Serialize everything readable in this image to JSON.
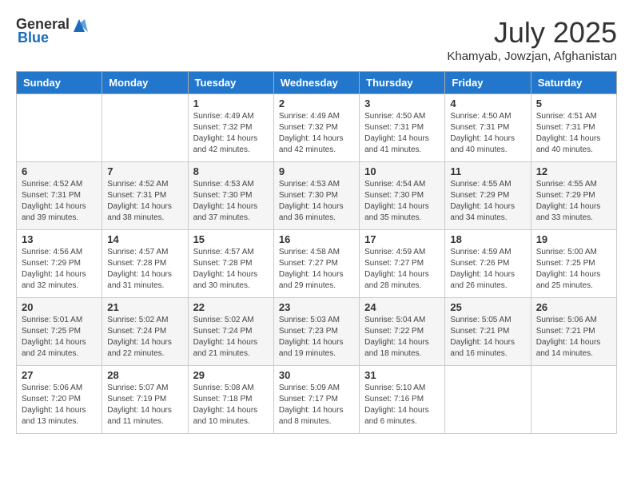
{
  "header": {
    "logo_general": "General",
    "logo_blue": "Blue",
    "month": "July 2025",
    "location": "Khamyab, Jowzjan, Afghanistan"
  },
  "weekdays": [
    "Sunday",
    "Monday",
    "Tuesday",
    "Wednesday",
    "Thursday",
    "Friday",
    "Saturday"
  ],
  "weeks": [
    [
      {
        "day": "",
        "sunrise": "",
        "sunset": "",
        "daylight": ""
      },
      {
        "day": "",
        "sunrise": "",
        "sunset": "",
        "daylight": ""
      },
      {
        "day": "1",
        "sunrise": "Sunrise: 4:49 AM",
        "sunset": "Sunset: 7:32 PM",
        "daylight": "Daylight: 14 hours and 42 minutes."
      },
      {
        "day": "2",
        "sunrise": "Sunrise: 4:49 AM",
        "sunset": "Sunset: 7:32 PM",
        "daylight": "Daylight: 14 hours and 42 minutes."
      },
      {
        "day": "3",
        "sunrise": "Sunrise: 4:50 AM",
        "sunset": "Sunset: 7:31 PM",
        "daylight": "Daylight: 14 hours and 41 minutes."
      },
      {
        "day": "4",
        "sunrise": "Sunrise: 4:50 AM",
        "sunset": "Sunset: 7:31 PM",
        "daylight": "Daylight: 14 hours and 40 minutes."
      },
      {
        "day": "5",
        "sunrise": "Sunrise: 4:51 AM",
        "sunset": "Sunset: 7:31 PM",
        "daylight": "Daylight: 14 hours and 40 minutes."
      }
    ],
    [
      {
        "day": "6",
        "sunrise": "Sunrise: 4:52 AM",
        "sunset": "Sunset: 7:31 PM",
        "daylight": "Daylight: 14 hours and 39 minutes."
      },
      {
        "day": "7",
        "sunrise": "Sunrise: 4:52 AM",
        "sunset": "Sunset: 7:31 PM",
        "daylight": "Daylight: 14 hours and 38 minutes."
      },
      {
        "day": "8",
        "sunrise": "Sunrise: 4:53 AM",
        "sunset": "Sunset: 7:30 PM",
        "daylight": "Daylight: 14 hours and 37 minutes."
      },
      {
        "day": "9",
        "sunrise": "Sunrise: 4:53 AM",
        "sunset": "Sunset: 7:30 PM",
        "daylight": "Daylight: 14 hours and 36 minutes."
      },
      {
        "day": "10",
        "sunrise": "Sunrise: 4:54 AM",
        "sunset": "Sunset: 7:30 PM",
        "daylight": "Daylight: 14 hours and 35 minutes."
      },
      {
        "day": "11",
        "sunrise": "Sunrise: 4:55 AM",
        "sunset": "Sunset: 7:29 PM",
        "daylight": "Daylight: 14 hours and 34 minutes."
      },
      {
        "day": "12",
        "sunrise": "Sunrise: 4:55 AM",
        "sunset": "Sunset: 7:29 PM",
        "daylight": "Daylight: 14 hours and 33 minutes."
      }
    ],
    [
      {
        "day": "13",
        "sunrise": "Sunrise: 4:56 AM",
        "sunset": "Sunset: 7:29 PM",
        "daylight": "Daylight: 14 hours and 32 minutes."
      },
      {
        "day": "14",
        "sunrise": "Sunrise: 4:57 AM",
        "sunset": "Sunset: 7:28 PM",
        "daylight": "Daylight: 14 hours and 31 minutes."
      },
      {
        "day": "15",
        "sunrise": "Sunrise: 4:57 AM",
        "sunset": "Sunset: 7:28 PM",
        "daylight": "Daylight: 14 hours and 30 minutes."
      },
      {
        "day": "16",
        "sunrise": "Sunrise: 4:58 AM",
        "sunset": "Sunset: 7:27 PM",
        "daylight": "Daylight: 14 hours and 29 minutes."
      },
      {
        "day": "17",
        "sunrise": "Sunrise: 4:59 AM",
        "sunset": "Sunset: 7:27 PM",
        "daylight": "Daylight: 14 hours and 28 minutes."
      },
      {
        "day": "18",
        "sunrise": "Sunrise: 4:59 AM",
        "sunset": "Sunset: 7:26 PM",
        "daylight": "Daylight: 14 hours and 26 minutes."
      },
      {
        "day": "19",
        "sunrise": "Sunrise: 5:00 AM",
        "sunset": "Sunset: 7:25 PM",
        "daylight": "Daylight: 14 hours and 25 minutes."
      }
    ],
    [
      {
        "day": "20",
        "sunrise": "Sunrise: 5:01 AM",
        "sunset": "Sunset: 7:25 PM",
        "daylight": "Daylight: 14 hours and 24 minutes."
      },
      {
        "day": "21",
        "sunrise": "Sunrise: 5:02 AM",
        "sunset": "Sunset: 7:24 PM",
        "daylight": "Daylight: 14 hours and 22 minutes."
      },
      {
        "day": "22",
        "sunrise": "Sunrise: 5:02 AM",
        "sunset": "Sunset: 7:24 PM",
        "daylight": "Daylight: 14 hours and 21 minutes."
      },
      {
        "day": "23",
        "sunrise": "Sunrise: 5:03 AM",
        "sunset": "Sunset: 7:23 PM",
        "daylight": "Daylight: 14 hours and 19 minutes."
      },
      {
        "day": "24",
        "sunrise": "Sunrise: 5:04 AM",
        "sunset": "Sunset: 7:22 PM",
        "daylight": "Daylight: 14 hours and 18 minutes."
      },
      {
        "day": "25",
        "sunrise": "Sunrise: 5:05 AM",
        "sunset": "Sunset: 7:21 PM",
        "daylight": "Daylight: 14 hours and 16 minutes."
      },
      {
        "day": "26",
        "sunrise": "Sunrise: 5:06 AM",
        "sunset": "Sunset: 7:21 PM",
        "daylight": "Daylight: 14 hours and 14 minutes."
      }
    ],
    [
      {
        "day": "27",
        "sunrise": "Sunrise: 5:06 AM",
        "sunset": "Sunset: 7:20 PM",
        "daylight": "Daylight: 14 hours and 13 minutes."
      },
      {
        "day": "28",
        "sunrise": "Sunrise: 5:07 AM",
        "sunset": "Sunset: 7:19 PM",
        "daylight": "Daylight: 14 hours and 11 minutes."
      },
      {
        "day": "29",
        "sunrise": "Sunrise: 5:08 AM",
        "sunset": "Sunset: 7:18 PM",
        "daylight": "Daylight: 14 hours and 10 minutes."
      },
      {
        "day": "30",
        "sunrise": "Sunrise: 5:09 AM",
        "sunset": "Sunset: 7:17 PM",
        "daylight": "Daylight: 14 hours and 8 minutes."
      },
      {
        "day": "31",
        "sunrise": "Sunrise: 5:10 AM",
        "sunset": "Sunset: 7:16 PM",
        "daylight": "Daylight: 14 hours and 6 minutes."
      },
      {
        "day": "",
        "sunrise": "",
        "sunset": "",
        "daylight": ""
      },
      {
        "day": "",
        "sunrise": "",
        "sunset": "",
        "daylight": ""
      }
    ]
  ]
}
